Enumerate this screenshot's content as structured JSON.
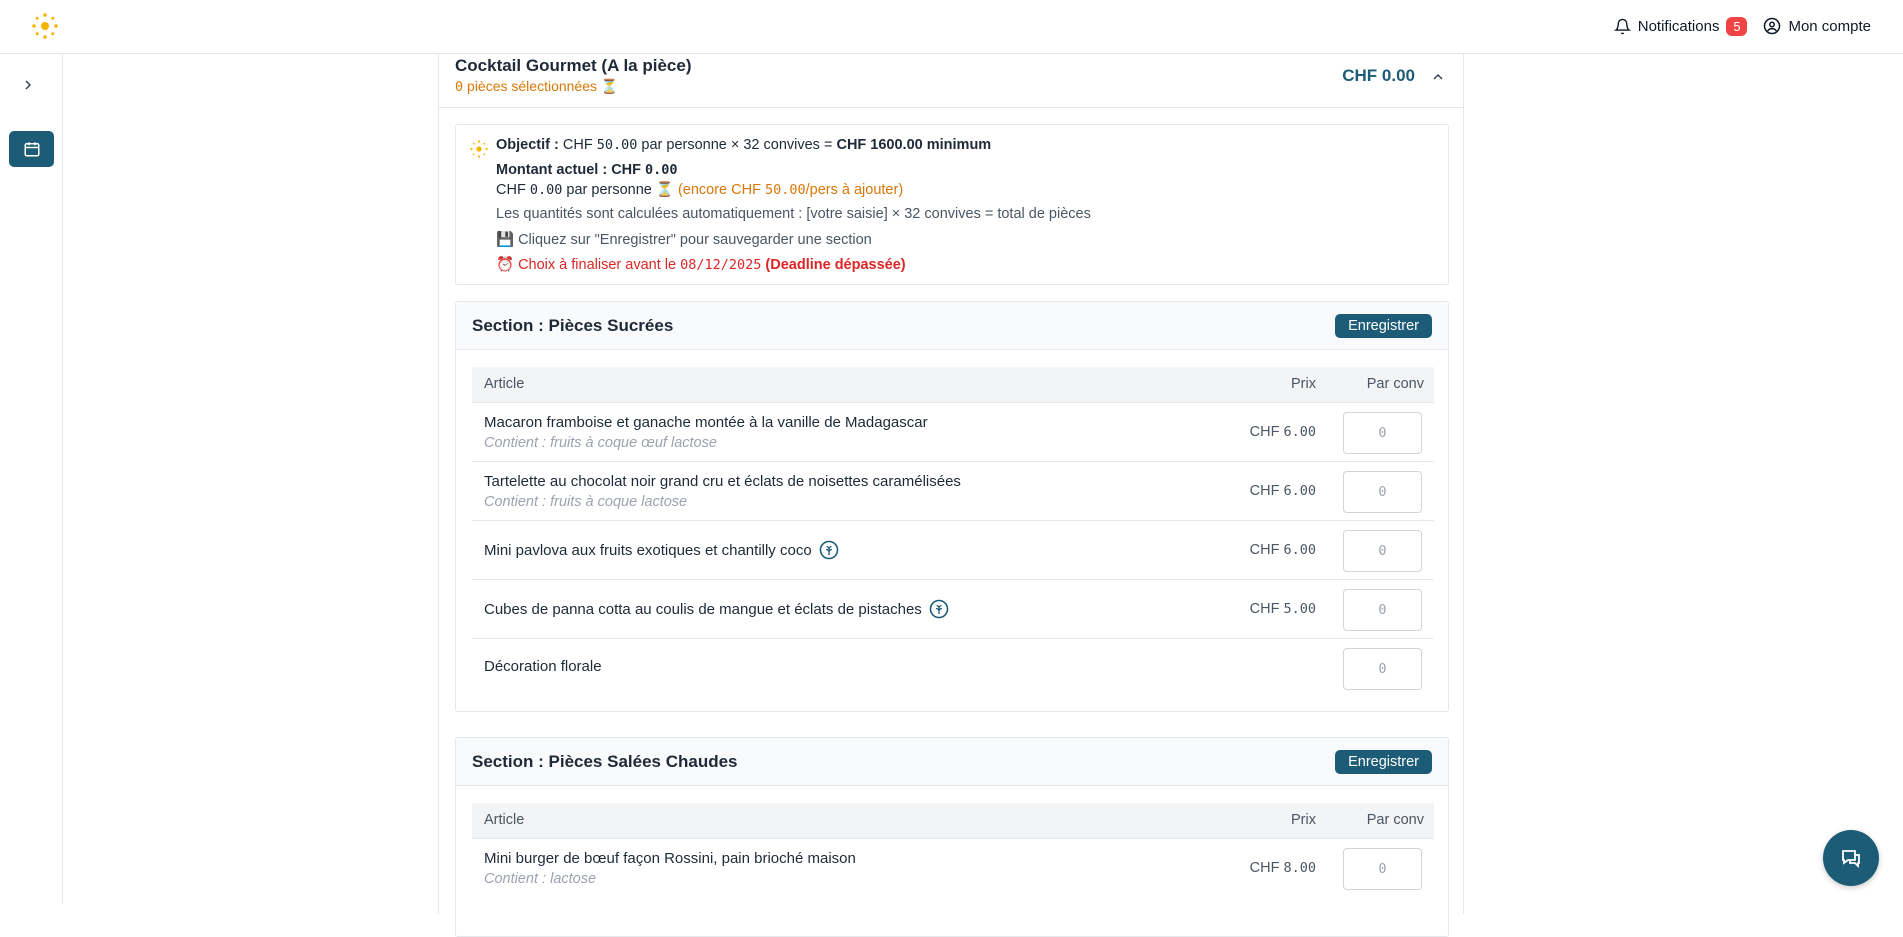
{
  "topbar": {
    "notifications_label": "Notifications",
    "notifications_count": "5",
    "account_label": "Mon compte"
  },
  "card": {
    "title": "Cocktail Gourmet (A la pièce)",
    "subtitle_count": "0",
    "subtitle_text": " pièces sélectionnées ⏳",
    "total": "CHF 0.00"
  },
  "info": {
    "objective_label": "Objectif :",
    "objective_chf": "CHF ",
    "objective_amount": "50.00",
    "objective_mid": " par personne × 32 convives = ",
    "objective_total": "CHF 1600.00 minimum",
    "current_label": "Montant actuel : CHF ",
    "current_amount": "0.00",
    "per_person_chf": "CHF ",
    "per_person_amount": "0.00",
    "per_person_text": " par personne ⏳ ",
    "remaining_prefix": "(encore CHF ",
    "remaining_amount": "50.00",
    "remaining_suffix": "/pers à ajouter)",
    "quantities_note": "Les quantités sont calculées automatiquement : [votre saisie] × 32 convives = total de pièces",
    "save_note": "💾 Cliquez sur \"Enregistrer\" pour sauvegarder une section",
    "deadline_prefix": "⏰ Choix à finaliser avant le ",
    "deadline_date": "08/12/2025",
    "deadline_status": " (Deadline dépassée)"
  },
  "table_headers": {
    "article": "Article",
    "prix": "Prix",
    "par_conv": "Par conv"
  },
  "qty_placeholder": "0",
  "sections": [
    {
      "title": "Section : Pièces Sucrées",
      "save_label": "Enregistrer",
      "items": [
        {
          "name": "Macaron framboise et ganache montée à la vanille de Madagascar",
          "allergens": "Contient : fruits à coque œuf lactose",
          "price_prefix": "CHF ",
          "price": "6.00"
        },
        {
          "name": "Tartelette au chocolat noir grand cru et éclats de noisettes caramélisées",
          "allergens": "Contient : fruits à coque lactose",
          "price_prefix": "CHF ",
          "price": "6.00"
        },
        {
          "name": "Mini pavlova aux fruits exotiques et chantilly coco",
          "allergens": "",
          "price_prefix": "CHF ",
          "price": "6.00",
          "icon": "vegan-icon"
        },
        {
          "name": "Cubes de panna cotta au coulis de mangue et éclats de pistaches",
          "allergens": "",
          "price_prefix": "CHF ",
          "price": "5.00",
          "icon": "vegan-icon"
        },
        {
          "name": "Décoration florale",
          "allergens": "",
          "price_prefix": "",
          "price": ""
        }
      ]
    },
    {
      "title": "Section : Pièces Salées Chaudes",
      "save_label": "Enregistrer",
      "items": [
        {
          "name": "Mini burger de bœuf façon Rossini, pain brioché maison",
          "allergens": "Contient : lactose",
          "price_prefix": "CHF ",
          "price": "8.00"
        }
      ]
    }
  ],
  "colors": {
    "primary": "#1d5c77",
    "warning": "#d97706",
    "danger": "#dc2626",
    "badge": "#ef4444",
    "logo": "#f5b400"
  },
  "icons": [
    "logo-sun-icon",
    "bell-icon",
    "user-circle-icon",
    "chevron-right-icon",
    "calendar-icon",
    "chevron-up-icon",
    "objective-sun-icon",
    "vegan-icon",
    "chat-icon"
  ]
}
